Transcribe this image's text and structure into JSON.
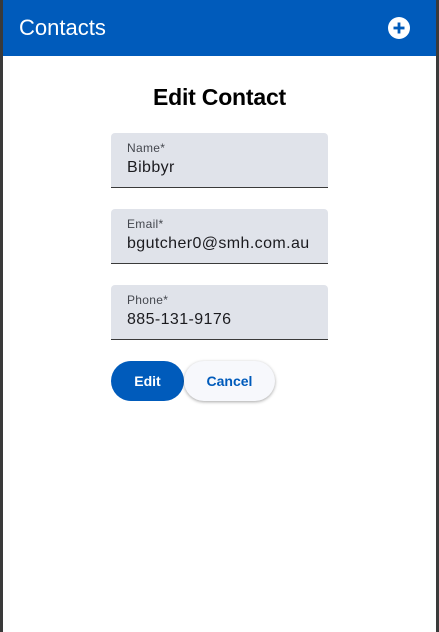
{
  "app_bar": {
    "title": "Contacts",
    "add_icon": "add-circle-icon",
    "color": "#005bbb"
  },
  "form": {
    "heading": "Edit Contact",
    "fields": [
      {
        "label": "Name*",
        "value": "Bibbyr"
      },
      {
        "label": "Email*",
        "value": "bgutcher0@smh.com.au"
      },
      {
        "label": "Phone*",
        "value": "885-131-9176"
      }
    ],
    "edit_label": "Edit",
    "cancel_label": "Cancel"
  }
}
